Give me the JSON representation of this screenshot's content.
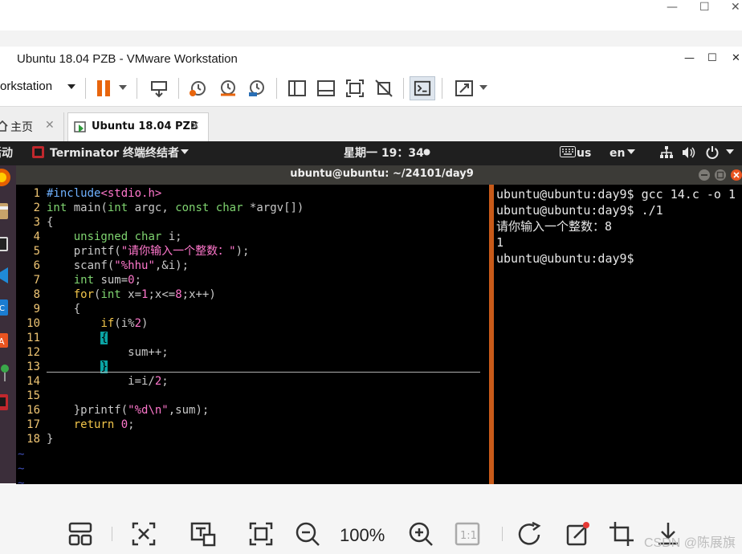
{
  "viewer": {
    "window_controls": {
      "minimize": "—",
      "maximize": "☐",
      "close": "✕"
    },
    "bottom_toolbar": {
      "zoom": "100%",
      "watermark": "CSDN @陈展旗"
    }
  },
  "vmware": {
    "title": "Ubuntu 18.04 PZB - VMware Workstation",
    "window_controls": {
      "minimize": "—",
      "maximize": "☐",
      "close": "✕"
    },
    "menu_label": "orkstation",
    "tabs": [
      {
        "label": "主页"
      },
      {
        "label": "Ubuntu 18.04 PZB"
      }
    ]
  },
  "ubuntu": {
    "activities": "活动",
    "app_menu": "Terminator 终端终结者",
    "clock": "星期一 19：34",
    "keyboard": "us",
    "language": "en"
  },
  "terminal": {
    "title": "ubuntu@ubuntu: ~/24101/day9",
    "vim_lines": [
      {
        "n": "1",
        "segs": [
          {
            "t": "#include",
            "c": "c-pre"
          },
          {
            "t": "<stdio.h>",
            "c": "c-str"
          }
        ]
      },
      {
        "n": "2",
        "segs": [
          {
            "t": "int",
            "c": "c-ty"
          },
          {
            "t": " main(",
            "c": "c-id"
          },
          {
            "t": "int",
            "c": "c-ty"
          },
          {
            "t": " argc, ",
            "c": "c-id"
          },
          {
            "t": "const",
            "c": "c-ty"
          },
          {
            "t": " ",
            "c": "c-id"
          },
          {
            "t": "char",
            "c": "c-ty"
          },
          {
            "t": " *argv[])",
            "c": "c-id"
          }
        ]
      },
      {
        "n": "3",
        "segs": [
          {
            "t": "{",
            "c": "c-id"
          }
        ]
      },
      {
        "n": "4",
        "segs": [
          {
            "t": "    ",
            "c": "c-id"
          },
          {
            "t": "unsigned",
            "c": "c-ty"
          },
          {
            "t": " ",
            "c": "c-id"
          },
          {
            "t": "char",
            "c": "c-ty"
          },
          {
            "t": " i;",
            "c": "c-id"
          }
        ]
      },
      {
        "n": "5",
        "segs": [
          {
            "t": "    printf(",
            "c": "c-id"
          },
          {
            "t": "\"请你输入一个整数：\"",
            "c": "c-str"
          },
          {
            "t": ");",
            "c": "c-id"
          }
        ]
      },
      {
        "n": "6",
        "segs": [
          {
            "t": "    scanf(",
            "c": "c-id"
          },
          {
            "t": "\"%hhu\"",
            "c": "c-str"
          },
          {
            "t": ",&i);",
            "c": "c-id"
          }
        ]
      },
      {
        "n": "7",
        "segs": [
          {
            "t": "    ",
            "c": "c-id"
          },
          {
            "t": "int",
            "c": "c-ty"
          },
          {
            "t": " sum=",
            "c": "c-id"
          },
          {
            "t": "0",
            "c": "c-num"
          },
          {
            "t": ";",
            "c": "c-id"
          }
        ]
      },
      {
        "n": "8",
        "segs": [
          {
            "t": "    ",
            "c": "c-id"
          },
          {
            "t": "for",
            "c": "c-kw"
          },
          {
            "t": "(",
            "c": "c-id"
          },
          {
            "t": "int",
            "c": "c-ty"
          },
          {
            "t": " x=",
            "c": "c-id"
          },
          {
            "t": "1",
            "c": "c-num"
          },
          {
            "t": ";x<=",
            "c": "c-id"
          },
          {
            "t": "8",
            "c": "c-num"
          },
          {
            "t": ";x++)",
            "c": "c-id"
          }
        ]
      },
      {
        "n": "9",
        "segs": [
          {
            "t": "    {",
            "c": "c-id"
          }
        ]
      },
      {
        "n": "10",
        "segs": [
          {
            "t": "        ",
            "c": "c-id"
          },
          {
            "t": "if",
            "c": "c-kw"
          },
          {
            "t": "(i%",
            "c": "c-id"
          },
          {
            "t": "2",
            "c": "c-num"
          },
          {
            "t": ")",
            "c": "c-id"
          }
        ]
      },
      {
        "n": "11",
        "segs": [
          {
            "t": "        ",
            "c": "c-id"
          },
          {
            "t": "{",
            "c": "c-cur"
          }
        ]
      },
      {
        "n": "12",
        "segs": [
          {
            "t": "            sum++;",
            "c": "c-id"
          }
        ]
      },
      {
        "n": "13",
        "segs": [
          {
            "t": "        ",
            "c": "c-id"
          },
          {
            "t": "}",
            "c": "c-cur"
          }
        ]
      },
      {
        "n": "14",
        "segs": [
          {
            "t": "            i=i/",
            "c": "c-id"
          },
          {
            "t": "2",
            "c": "c-num"
          },
          {
            "t": ";",
            "c": "c-id"
          }
        ]
      },
      {
        "n": "15",
        "segs": []
      },
      {
        "n": "16",
        "segs": [
          {
            "t": "    }printf(",
            "c": "c-id"
          },
          {
            "t": "\"%d\\n\"",
            "c": "c-str"
          },
          {
            "t": ",sum);",
            "c": "c-id"
          }
        ]
      },
      {
        "n": "17",
        "segs": [
          {
            "t": "    ",
            "c": "c-id"
          },
          {
            "t": "return",
            "c": "c-kw"
          },
          {
            "t": " ",
            "c": "c-id"
          },
          {
            "t": "0",
            "c": "c-num"
          },
          {
            "t": ";",
            "c": "c-id"
          }
        ]
      },
      {
        "n": "18",
        "segs": [
          {
            "t": "}",
            "c": "c-id"
          }
        ]
      }
    ],
    "tilde": "~",
    "shell_lines": [
      "ubuntu@ubuntu:day9$ gcc 14.c -o 1",
      "ubuntu@ubuntu:day9$ ./1",
      "请你输入一个整数：8",
      "1",
      "ubuntu@ubuntu:day9$"
    ]
  },
  "colors": {
    "divider": "#c85a19",
    "cursor": "#0aa3a3",
    "line_number": "#f0c674",
    "string": "#ff77cc",
    "type": "#7fd470",
    "keyword": "#f3c64b"
  }
}
